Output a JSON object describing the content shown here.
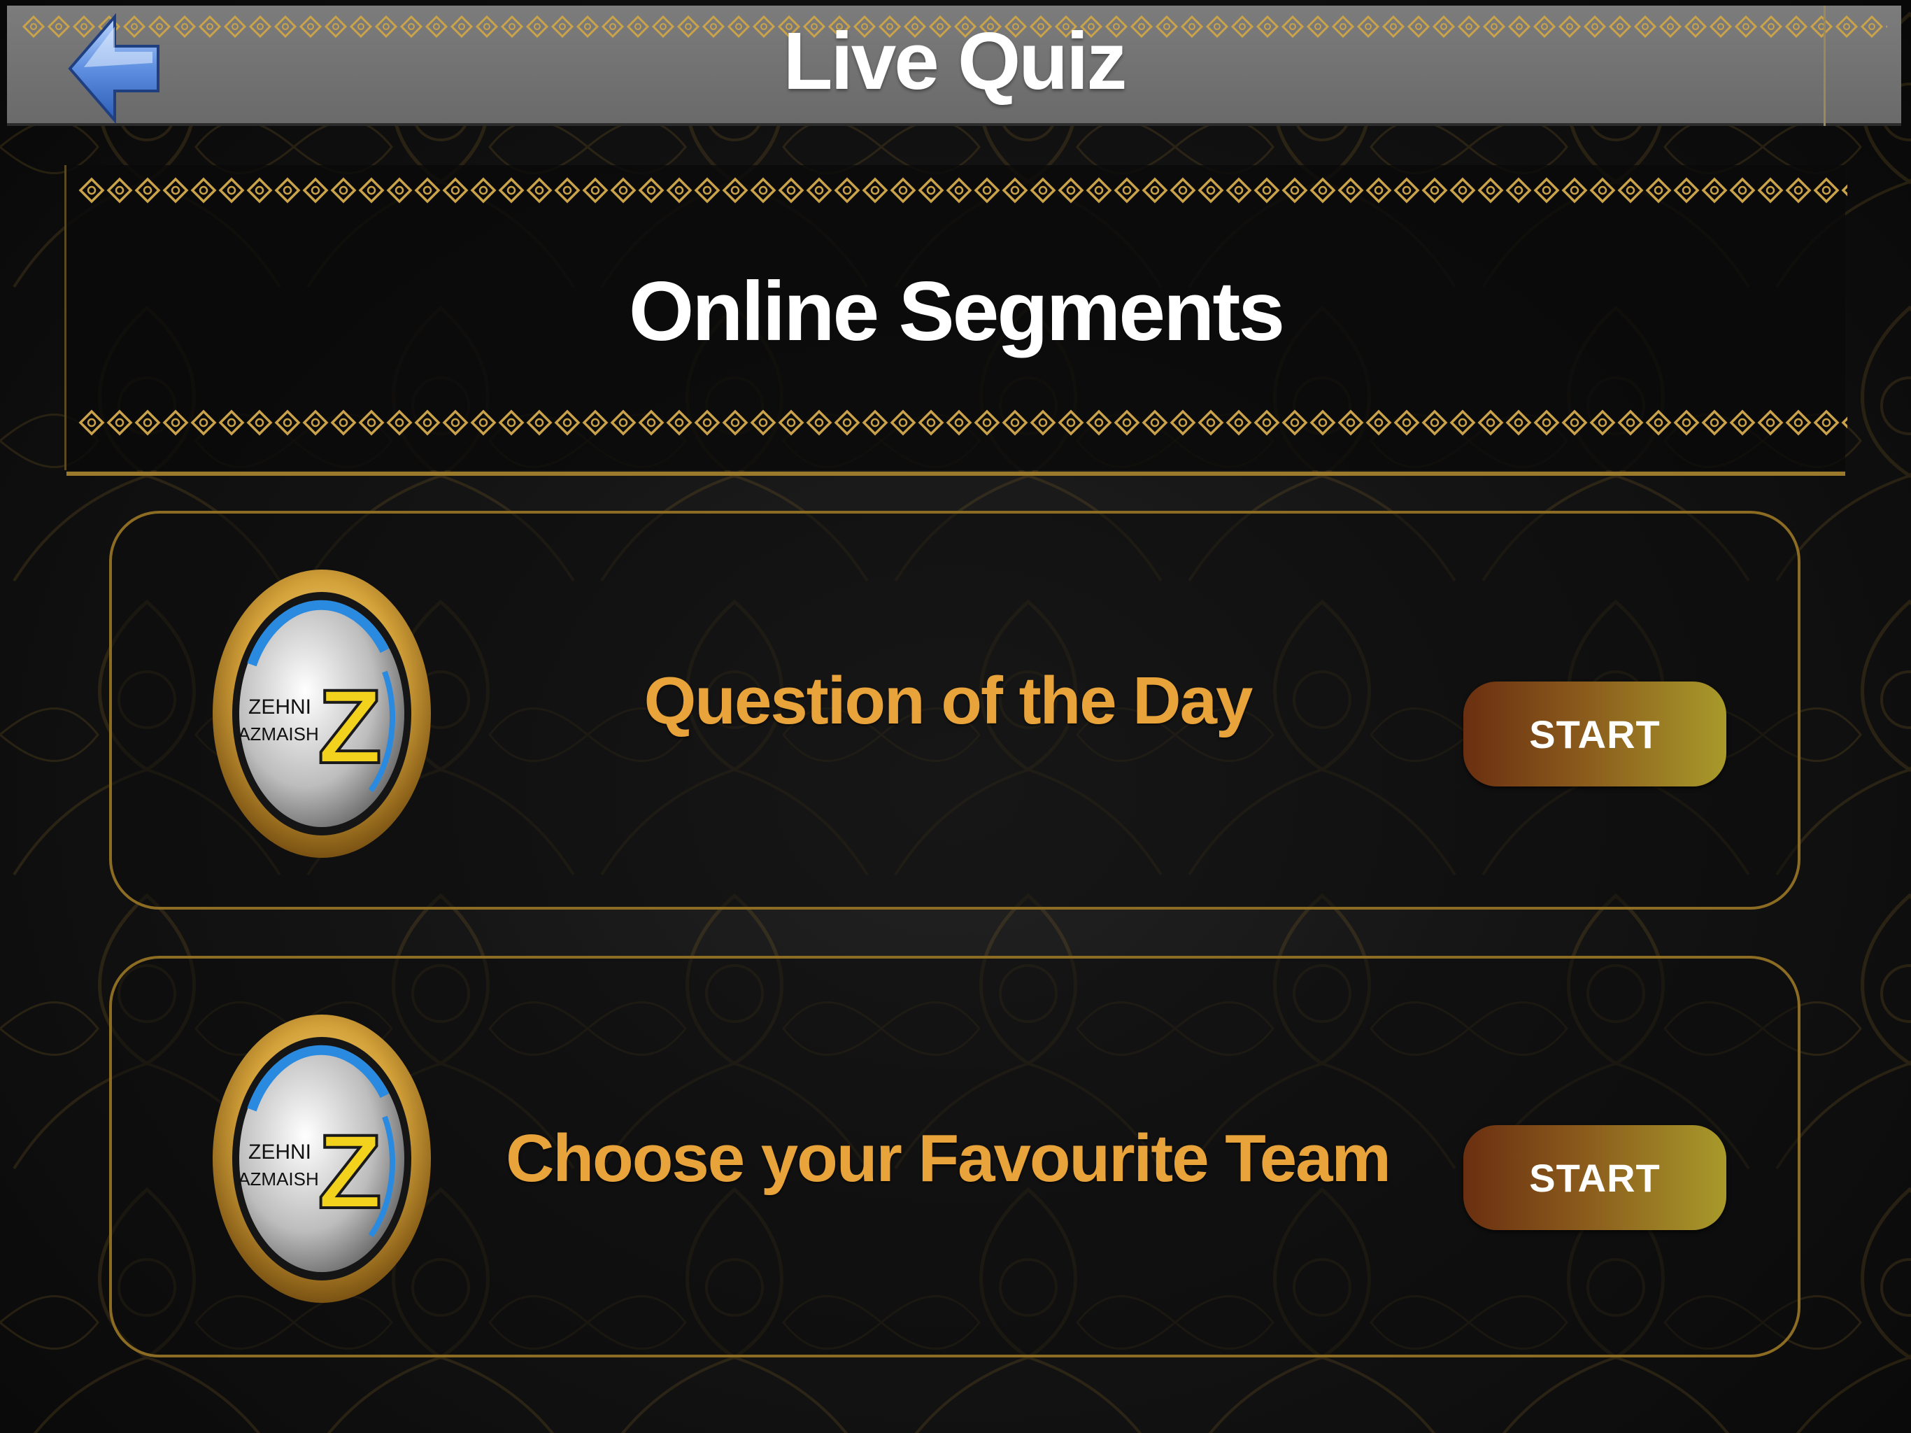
{
  "header": {
    "title": "Live Quiz",
    "back_icon": "back-arrow-icon"
  },
  "heading": {
    "text": "Online Segments"
  },
  "segments": [
    {
      "label": "Question of the Day",
      "button_label": "START",
      "logo_icon": "zehni-azmaish-logo-icon",
      "logo_text_top": "ZEHNI",
      "logo_text_bottom": "AZMAISH",
      "logo_letter": "Z"
    },
    {
      "label": "Choose your Favourite Team",
      "button_label": "START",
      "logo_icon": "zehni-azmaish-logo-icon",
      "logo_text_top": "ZEHNI",
      "logo_text_bottom": "AZMAISH",
      "logo_letter": "Z"
    }
  ],
  "colors": {
    "topbar": "#6f6f6f",
    "accent_gold": "#e8a43a",
    "card_border": "#8c6c22",
    "button_start": "#6a2f10",
    "button_end": "#a89a2a"
  }
}
